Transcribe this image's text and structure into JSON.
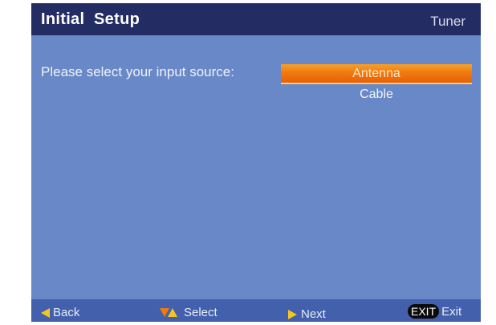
{
  "header": {
    "title": "Initial  Setup",
    "section": "Tuner"
  },
  "main": {
    "prompt": "Please select your input source:",
    "options": [
      {
        "label": "Antenna",
        "selected": true
      },
      {
        "label": "Cable",
        "selected": false
      }
    ]
  },
  "footer": {
    "back_label": "Back",
    "back_icon": "left-arrow-icon",
    "select_label": "Select",
    "select_icon": "up-down-arrows-icon",
    "next_label": "Next",
    "next_icon": "right-arrow-icon",
    "exit_key": "EXIT",
    "exit_label": "Exit"
  },
  "colors": {
    "background": "#6888c8",
    "header": "#242c64",
    "footer": "#4260ac",
    "highlight": "#f07a10",
    "arrow": "#f5c623"
  }
}
